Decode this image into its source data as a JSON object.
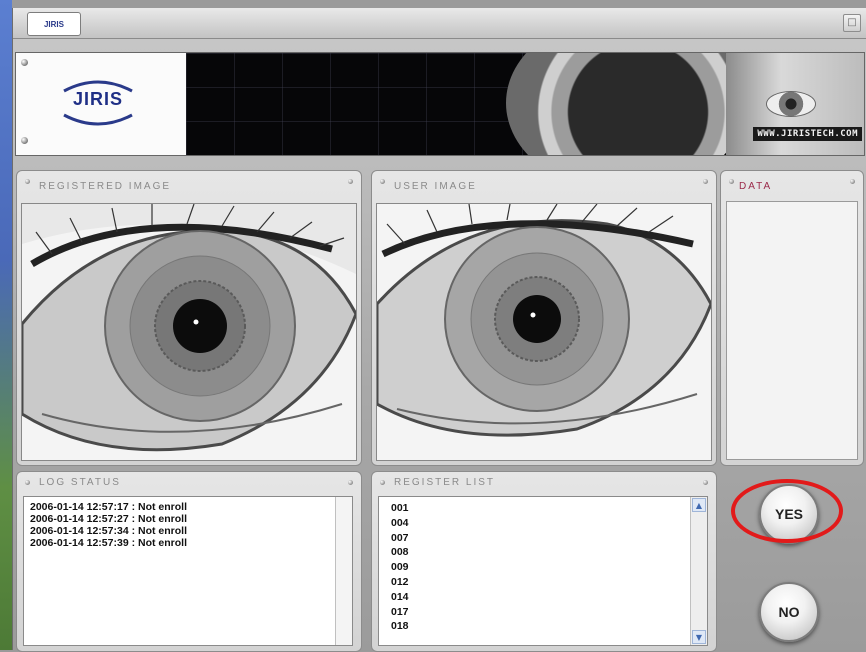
{
  "titlebar": {
    "logo_text": "JIRIS",
    "close_glyph": "□"
  },
  "banner": {
    "brand": "JIRIS",
    "url": "WWW.JIRISTECH.COM"
  },
  "panels": {
    "registered_image": "REGISTERED IMAGE",
    "user_image": "USER IMAGE",
    "data": "DATA",
    "log_status": "LOG STATUS",
    "register_list": "REGISTER LIST"
  },
  "log_status": {
    "lines": [
      "2006-01-14 12:57:17 : Not enroll",
      "2006-01-14 12:57:27 : Not enroll",
      "2006-01-14 12:57:34 : Not enroll",
      "2006-01-14 12:57:39 : Not enroll"
    ]
  },
  "register_list": {
    "items": [
      "001",
      "004",
      "007",
      "008",
      "009",
      "012",
      "014",
      "017",
      "018"
    ]
  },
  "buttons": {
    "yes": "YES",
    "no": "NO"
  },
  "colors": {
    "highlight": "#e21a1a",
    "data_label": "#9b2a4a",
    "brand": "#1f2f86"
  },
  "icons": [
    "window-logo-icon",
    "close-icon",
    "scroll-up-icon",
    "scroll-down-icon"
  ]
}
